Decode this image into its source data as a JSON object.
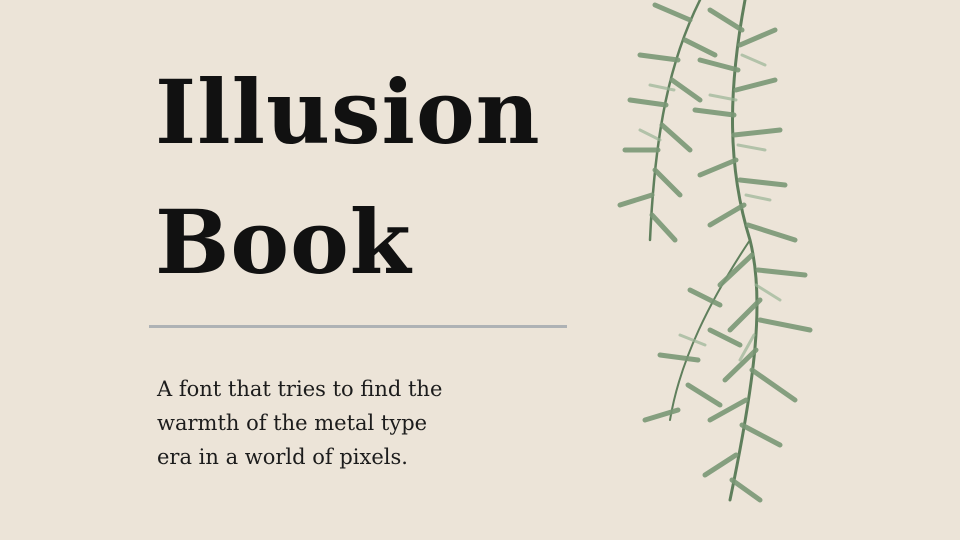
{
  "title": {
    "line1": "Illusion",
    "line2": "Book"
  },
  "tagline": {
    "line1": "A font that tries to find the",
    "line2": "warmth of the metal type",
    "line3": "era in a world of pixels."
  },
  "colors": {
    "background": "#ece4d8",
    "text": "#111111",
    "divider": "#aeb2b5",
    "leaf": "#6f8f6c"
  },
  "icons": {
    "decoration": "hanging-rosemary-sprigs"
  }
}
